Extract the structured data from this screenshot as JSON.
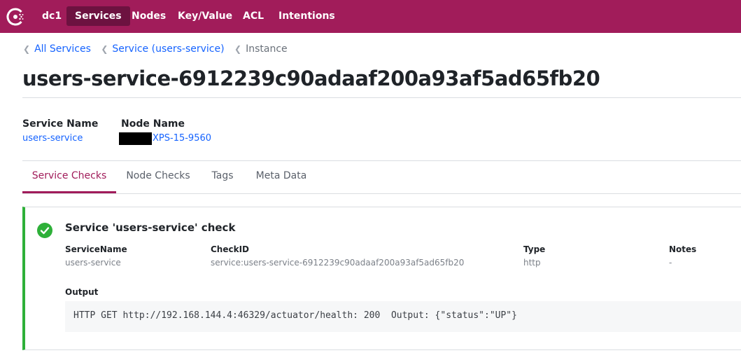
{
  "nav": {
    "logo_icon": "consul-logo-icon",
    "datacenter": "dc1",
    "items": [
      {
        "label": "Services",
        "active": true
      },
      {
        "label": "Nodes",
        "active": false
      },
      {
        "label": "Key/Value",
        "active": false
      },
      {
        "label": "ACL",
        "active": false
      },
      {
        "label": "Intentions",
        "active": false
      }
    ],
    "background_color": "#a11c5a",
    "active_color": "#6d1240"
  },
  "breadcrumbs": [
    {
      "label": "All Services",
      "link": true
    },
    {
      "label": "Service (users-service)",
      "link": true
    },
    {
      "label": "Instance",
      "link": false
    }
  ],
  "page": {
    "title": "users-service-6912239c90adaaf200a93af5ad65fb20"
  },
  "meta": {
    "service_name_label": "Service Name",
    "service_name_value": "users-service",
    "node_name_label": "Node Name",
    "node_name_value": "XPS-15-9560"
  },
  "tabs": [
    {
      "label": "Service Checks",
      "active": true
    },
    {
      "label": "Node Checks",
      "active": false
    },
    {
      "label": "Tags",
      "active": false
    },
    {
      "label": "Meta Data",
      "active": false
    }
  ],
  "check": {
    "status": "passing",
    "status_icon": "check-circle-icon",
    "status_color": "#2eb039",
    "title": "Service 'users-service' check",
    "fields": {
      "service_name": {
        "label": "ServiceName",
        "value": "users-service"
      },
      "check_id": {
        "label": "CheckID",
        "value": "service:users-service-6912239c90adaaf200a93af5ad65fb20"
      },
      "type": {
        "label": "Type",
        "value": "http"
      },
      "notes": {
        "label": "Notes",
        "value": "-"
      }
    },
    "output_label": "Output",
    "output": "HTTP GET http://192.168.144.4:46329/actuator/health: 200  Output: {\"status\":\"UP\"}"
  },
  "colors": {
    "link": "#1563ff",
    "accent": "#a11c5a"
  }
}
